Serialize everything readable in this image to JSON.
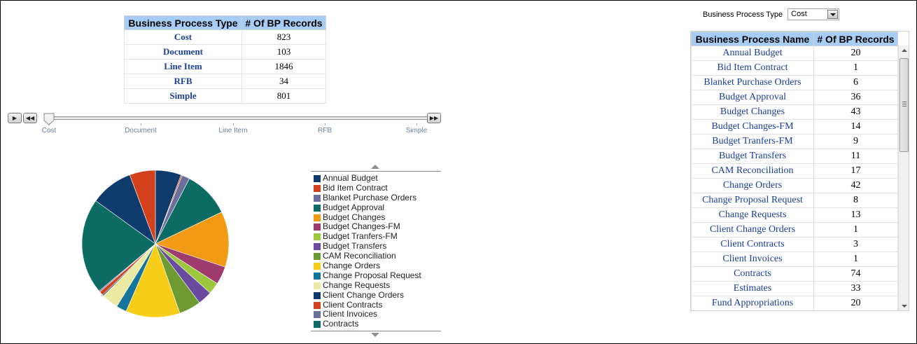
{
  "summary": {
    "headers": [
      "Business Process Type",
      "# Of BP Records"
    ],
    "rows": [
      {
        "type": "Cost",
        "count": "823"
      },
      {
        "type": "Document",
        "count": "103"
      },
      {
        "type": "Line Item",
        "count": "1846"
      },
      {
        "type": "RFB",
        "count": "34"
      },
      {
        "type": "Simple",
        "count": "801"
      }
    ]
  },
  "slider": {
    "labels": [
      "Cost",
      "Document",
      "Line Item",
      "RFB",
      "Simple"
    ],
    "selected": "Cost",
    "play_icon": "play-icon",
    "rewind_icon": "rewind-icon",
    "forward_icon": "fast-forward-icon"
  },
  "filter": {
    "label": "Business Process Type",
    "value": "Cost"
  },
  "detail": {
    "headers": [
      "Business Process Name",
      "# Of BP Records"
    ],
    "rows": [
      {
        "name": "Annual Budget",
        "count": "20"
      },
      {
        "name": "Bid Item Contract",
        "count": "1"
      },
      {
        "name": "Blanket Purchase Orders",
        "count": "6"
      },
      {
        "name": "Budget Approval",
        "count": "36"
      },
      {
        "name": "Budget Changes",
        "count": "43"
      },
      {
        "name": "Budget Changes-FM",
        "count": "14"
      },
      {
        "name": "Budget Tranfers-FM",
        "count": "9"
      },
      {
        "name": "Budget Transfers",
        "count": "11"
      },
      {
        "name": "CAM Reconciliation",
        "count": "17"
      },
      {
        "name": "Change Orders",
        "count": "42"
      },
      {
        "name": "Change Proposal Request",
        "count": "8"
      },
      {
        "name": "Change Requests",
        "count": "13"
      },
      {
        "name": "Client Change Orders",
        "count": "1"
      },
      {
        "name": "Client Contracts",
        "count": "3"
      },
      {
        "name": "Client Invoices",
        "count": "1"
      },
      {
        "name": "Contracts",
        "count": "74"
      },
      {
        "name": "Estimates",
        "count": "33"
      },
      {
        "name": "Fund Appropriations",
        "count": "20"
      }
    ]
  },
  "legend": {
    "items": [
      {
        "label": "Annual Budget",
        "color": "#0e3b6b"
      },
      {
        "label": "Bid Item Contract",
        "color": "#d2401c"
      },
      {
        "label": "Blanket Purchase Orders",
        "color": "#6a6f9e"
      },
      {
        "label": "Budget Approval",
        "color": "#0c6b62"
      },
      {
        "label": "Budget Changes",
        "color": "#f39a14"
      },
      {
        "label": "Budget Changes-FM",
        "color": "#9e3a6c"
      },
      {
        "label": "Budget Tranfers-FM",
        "color": "#9bc83c"
      },
      {
        "label": "Budget Transfers",
        "color": "#6a4a9e"
      },
      {
        "label": "CAM Reconciliation",
        "color": "#6d9a32"
      },
      {
        "label": "Change Orders",
        "color": "#f7cf1a"
      },
      {
        "label": "Change Proposal Request",
        "color": "#14749c"
      },
      {
        "label": "Change Requests",
        "color": "#eaeaa2"
      },
      {
        "label": "Client Change Orders",
        "color": "#0e3b6b"
      },
      {
        "label": "Client Contracts",
        "color": "#d2401c"
      },
      {
        "label": "Client Invoices",
        "color": "#6a6f9e"
      },
      {
        "label": "Contracts",
        "color": "#0c6b62"
      }
    ]
  },
  "chart_data": {
    "type": "pie",
    "title": "",
    "categories": [
      "Annual Budget",
      "Bid Item Contract",
      "Blanket Purchase Orders",
      "Budget Approval",
      "Budget Changes",
      "Budget Changes-FM",
      "Budget Tranfers-FM",
      "Budget Transfers",
      "CAM Reconciliation",
      "Change Orders",
      "Change Proposal Request",
      "Change Requests",
      "Client Change Orders",
      "Client Contracts",
      "Client Invoices",
      "Contracts",
      "Estimates",
      "Fund Appropriations"
    ],
    "values": [
      20,
      1,
      6,
      36,
      43,
      14,
      9,
      11,
      17,
      42,
      8,
      13,
      1,
      3,
      1,
      74,
      33,
      20
    ],
    "legend": "right"
  }
}
